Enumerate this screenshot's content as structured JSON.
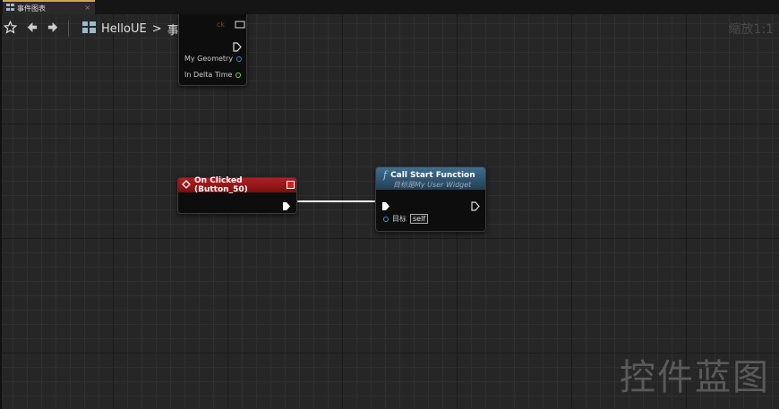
{
  "tab": {
    "title": "事件图表"
  },
  "breadcrumb": {
    "project": "HelloUE",
    "separator": ">",
    "graph": "事件图表"
  },
  "zoom": {
    "label": "缩放1:1"
  },
  "watermark": {
    "text": "控件蓝图"
  },
  "tick_node": {
    "title_fragment": "ck",
    "pins": [
      {
        "label": "My Geometry",
        "color": "#3b7fd4"
      },
      {
        "label": "In Delta Time",
        "color": "#7ccf3a"
      }
    ]
  },
  "clicked_node": {
    "title": "On Clicked (Button_50)",
    "header_color": "#a01818"
  },
  "call_node": {
    "function_glyph": "f",
    "title": "Call Start Function",
    "subtitle": "目标是My User Widget",
    "target_label": "目标",
    "target_value": "self",
    "header_color": "#2f5774"
  }
}
